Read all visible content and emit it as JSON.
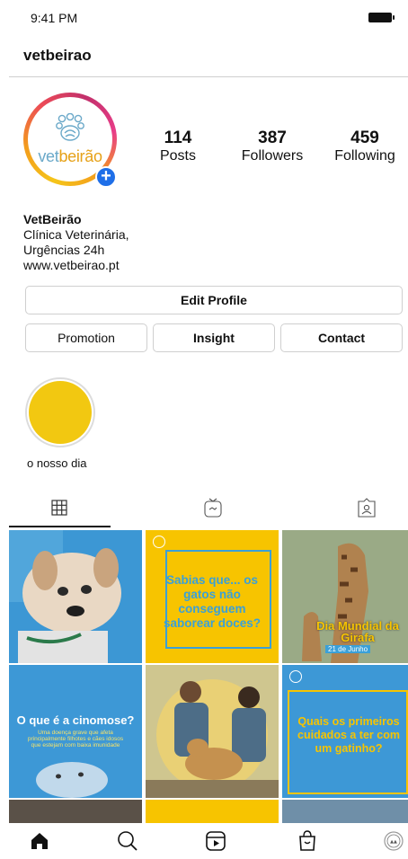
{
  "status_bar": {
    "time": "9:41 PM"
  },
  "header": {
    "username": "vetbeirao"
  },
  "avatar": {
    "logo_text_prefix": "vet",
    "logo_text_highlight": "beirão"
  },
  "stats": [
    {
      "value": "114",
      "label": "Posts"
    },
    {
      "value": "387",
      "label": "Followers"
    },
    {
      "value": "459",
      "label": "Following"
    }
  ],
  "bio": {
    "name": "VetBeirão",
    "lines": [
      "Clínica Veterinária,",
      "Urgências 24h",
      "www.vetbeirao.pt"
    ]
  },
  "buttons": {
    "edit_profile": "Edit Profile",
    "promotion": "Promotion",
    "insight": "Insight",
    "contact": "Contact"
  },
  "highlights": [
    {
      "label": "o nosso dia",
      "color": "#f2c811"
    }
  ],
  "tabs": [
    {
      "icon": "grid-icon",
      "active": true
    },
    {
      "icon": "igtv-icon",
      "active": false
    },
    {
      "icon": "tagged-icon",
      "active": false
    }
  ],
  "grid": {
    "brand_mark": "vetbeirão",
    "posts": [
      {
        "kind": "photo-dog",
        "text": ""
      },
      {
        "kind": "yellow-card",
        "text": "Sabias que... os gatos não conseguem saborear doces?"
      },
      {
        "kind": "photo-giraffe",
        "title": "Dia Mundial da Girafa",
        "caption": "21 de Junho"
      },
      {
        "kind": "blue-card",
        "title": "O que é a cinomose?",
        "body": "Uma doença grave que afeta principalmente filhotes e cães idosos que estejam com baixa imunidade"
      },
      {
        "kind": "photo-vets",
        "text": ""
      },
      {
        "kind": "blue-card-yellow",
        "text": "Quais os primeiros cuidados a ter com um gatinho?"
      }
    ]
  },
  "bottom_nav": [
    "home-icon",
    "search-icon",
    "reels-icon",
    "shop-icon",
    "profile-icon"
  ],
  "colors": {
    "brand_yellow": "#f7c400",
    "brand_blue": "#3d98d6",
    "accent_blue": "#1f6fe8"
  }
}
